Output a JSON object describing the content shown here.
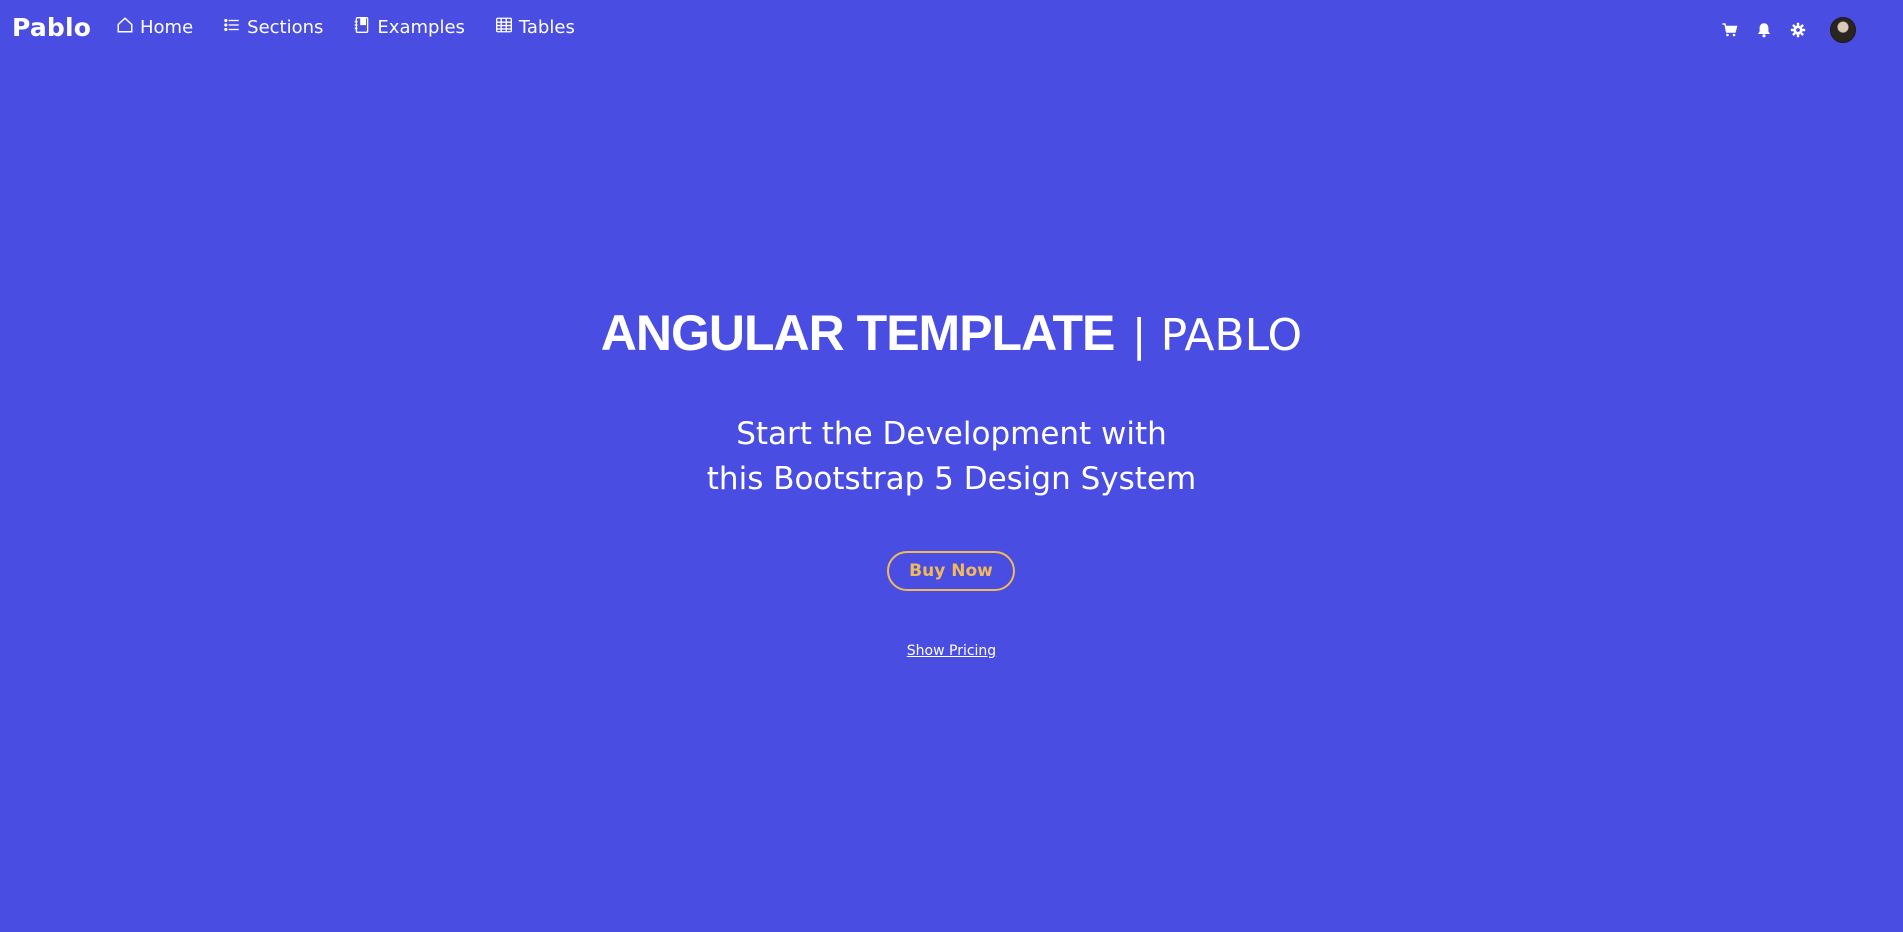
{
  "navbar": {
    "brand": "Pablo",
    "links": [
      {
        "label": "Home",
        "icon": "home-icon"
      },
      {
        "label": "Sections",
        "icon": "list-icon"
      },
      {
        "label": "Examples",
        "icon": "book-icon"
      },
      {
        "label": "Tables",
        "icon": "table-icon"
      }
    ],
    "right_icons": [
      "cart-icon",
      "bell-icon",
      "gear-icon",
      "avatar"
    ]
  },
  "hero": {
    "title_strong": "ANGULAR TEMPLATE",
    "title_light": "| PABLO",
    "subtitle_line1": "Start the Development with",
    "subtitle_line2": "this Bootstrap 5 Design System",
    "cta_label": "Buy Now",
    "pricing_label": "Show Pricing"
  },
  "colors": {
    "background": "#4a4de1",
    "accent": "#f0b95b",
    "text": "#ffffff"
  }
}
